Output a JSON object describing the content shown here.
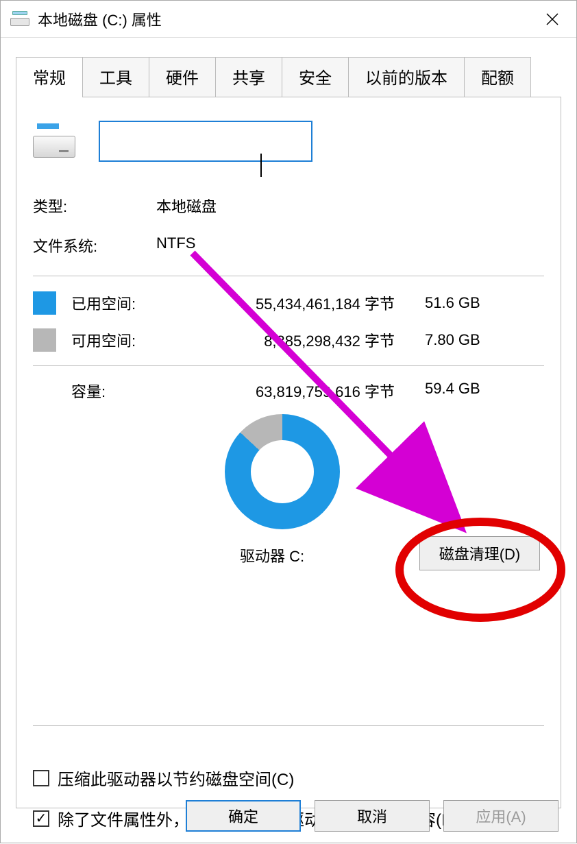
{
  "window": {
    "title": "本地磁盘 (C:) 属性"
  },
  "tabs": {
    "general": "常规",
    "tools": "工具",
    "hardware": "硬件",
    "sharing": "共享",
    "security": "安全",
    "previous": "以前的版本",
    "quota": "配额"
  },
  "volume_name": {
    "value": ""
  },
  "type_row": {
    "label": "类型:",
    "value": "本地磁盘"
  },
  "fs_row": {
    "label": "文件系统:",
    "value": "NTFS"
  },
  "used": {
    "label": "已用空间:",
    "bytes": "55,434,461,184 字节",
    "gb": "51.6 GB",
    "color": "#1e98e4"
  },
  "free": {
    "label": "可用空间:",
    "bytes": "8,385,298,432 字节",
    "gb": "7.80 GB",
    "color": "#b7b7b7"
  },
  "capacity": {
    "label": "容量:",
    "bytes": "63,819,759,616 字节",
    "gb": "59.4 GB"
  },
  "drive_label": "驱动器 C:",
  "cleanup_button": "磁盘清理(D)",
  "compress_checkbox": {
    "checked": false,
    "label": "压缩此驱动器以节约磁盘空间(C)"
  },
  "index_checkbox": {
    "checked": true,
    "label": "除了文件属性外，还允许索引此驱动器上文件的内容(I)"
  },
  "footer": {
    "ok": "确定",
    "cancel": "取消",
    "apply": "应用(A)"
  },
  "annotation": {
    "highlighted_button": "cleanup",
    "arrow_color": "#d400d4",
    "ellipse_color": "#e10000"
  }
}
